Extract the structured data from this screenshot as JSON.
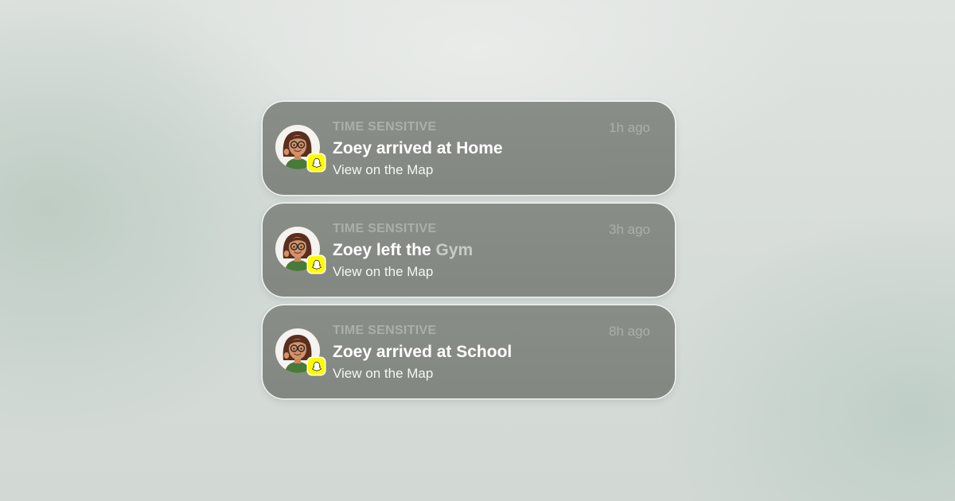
{
  "notifications": [
    {
      "category": "TIME SENSITIVE",
      "time": "1h ago",
      "title": "Zoey arrived at Home",
      "title_main": "Zoey arrived at Home",
      "title_faint": "",
      "subtitle": "View on the Map",
      "app_icon": "snapchat-ghost-icon",
      "avatar": "bitmoji-avatar"
    },
    {
      "category": "TIME SENSITIVE",
      "time": "3h ago",
      "title": "Zoey left the Gym",
      "title_main": "Zoey left the ",
      "title_faint": "Gym",
      "subtitle": "View on the Map",
      "app_icon": "snapchat-ghost-icon",
      "avatar": "bitmoji-avatar"
    },
    {
      "category": "TIME SENSITIVE",
      "time": "8h ago",
      "title": "Zoey arrived at School",
      "title_main": "Zoey arrived at School",
      "title_faint": "",
      "subtitle": "View on the Map",
      "app_icon": "snapchat-ghost-icon",
      "avatar": "bitmoji-avatar"
    }
  ],
  "colors": {
    "card": "#868a84",
    "badge": "#fffc00",
    "title": "#ffffff",
    "meta": "#c8ccc6"
  }
}
